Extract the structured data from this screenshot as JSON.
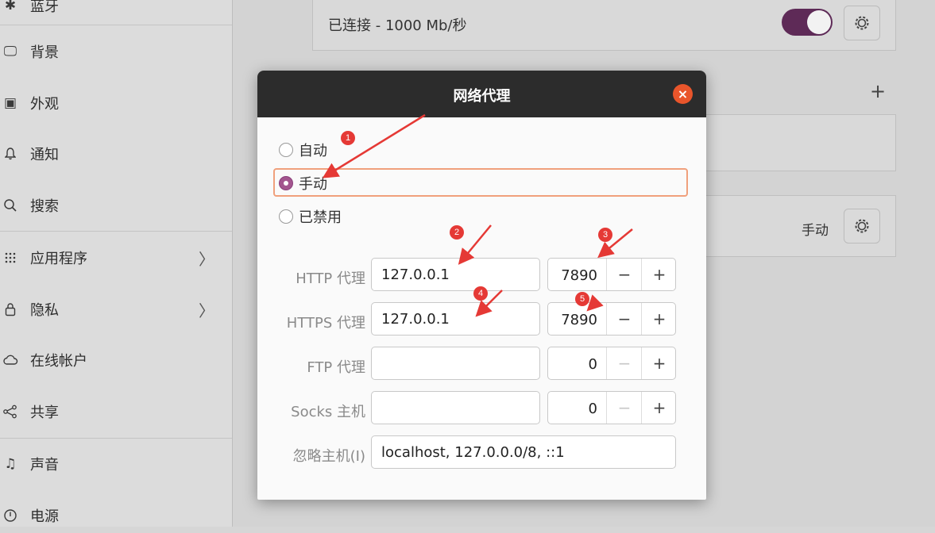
{
  "sidebar": {
    "items": [
      {
        "label": "蓝牙",
        "icon": "bluetooth-icon",
        "glyph": "✱"
      },
      {
        "label": "背景",
        "icon": "background-icon",
        "glyph": "🖵"
      },
      {
        "label": "外观",
        "icon": "appearance-icon",
        "glyph": "▣"
      },
      {
        "label": "通知",
        "icon": "bell-icon",
        "glyph": "♫"
      },
      {
        "label": "搜索",
        "icon": "search-icon",
        "glyph": "⌕"
      },
      {
        "label": "应用程序",
        "icon": "apps-grid-icon",
        "glyph": "⁙",
        "chevron": "〉"
      },
      {
        "label": "隐私",
        "icon": "lock-icon",
        "glyph": "🔒",
        "chevron": "〉"
      },
      {
        "label": "在线帐户",
        "icon": "cloud-icon",
        "glyph": "☁"
      },
      {
        "label": "共享",
        "icon": "share-icon",
        "glyph": "⋖"
      },
      {
        "label": "声音",
        "icon": "music-note-icon",
        "glyph": "♫"
      },
      {
        "label": "电源",
        "icon": "power-icon",
        "glyph": "⏻"
      }
    ]
  },
  "main": {
    "wired_status": "已连接 - 1000 Mb/秒",
    "wired_toggle_on": true,
    "proxy_mode": "手动",
    "add_symbol": "+"
  },
  "dialog": {
    "title": "网络代理",
    "close_symbol": "×",
    "modes": [
      "自动",
      "手动",
      "已禁用"
    ],
    "selected_mode": "手动",
    "rows": [
      {
        "label": "HTTP 代理",
        "host": "127.0.0.1",
        "port": "7890"
      },
      {
        "label": "HTTPS 代理",
        "host": "127.0.0.1",
        "port": "7890"
      },
      {
        "label": "FTP 代理",
        "host": "",
        "port": "0"
      },
      {
        "label": "Socks 主机",
        "host": "",
        "port": "0"
      }
    ],
    "ignore_label": "忽略主机(I)",
    "ignore_hosts": "localhost, 127.0.0.0/8, ::1",
    "minus_symbol": "−",
    "plus_symbol": "+"
  },
  "annotations": {
    "badges": [
      "1",
      "2",
      "3",
      "4",
      "5"
    ],
    "color": "#e53935"
  },
  "colors": {
    "accent": "#a3558f",
    "toggle": "#5e2a57",
    "close": "#e9552b",
    "highlight": "#f0a07c"
  }
}
